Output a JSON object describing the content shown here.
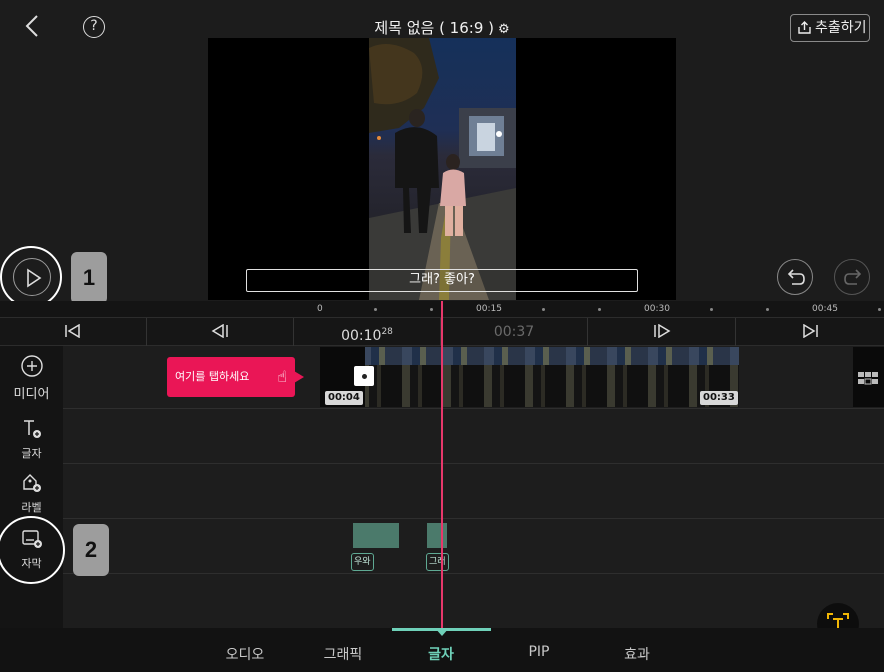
{
  "header": {
    "title": "제목 없음 ( 16:9 )",
    "export_label": "추출하기",
    "help_glyph": "?"
  },
  "preview": {
    "subtitle_text": "그래? 좋아?"
  },
  "annotations": {
    "badge_1": "1",
    "badge_2": "2"
  },
  "ruler": {
    "ticks": [
      "0",
      "00:15",
      "00:30",
      "00:45"
    ]
  },
  "navigation": {
    "current_time": "00:10",
    "current_frame": "28",
    "total_time": "00:37"
  },
  "sidebar": {
    "items": [
      {
        "label": "미디어",
        "icon": "add-circle-icon"
      },
      {
        "label": "글자",
        "icon": "text-add-icon"
      },
      {
        "label": "라벨",
        "icon": "label-add-icon"
      },
      {
        "label": "자막",
        "icon": "caption-add-icon"
      }
    ]
  },
  "timeline": {
    "tooltip": "여기를 탭하세요",
    "clip_start": "00:04",
    "clip_end": "00:33",
    "caption_clips": [
      "우와",
      "그래"
    ]
  },
  "tabs": [
    {
      "label": "오디오",
      "active": false
    },
    {
      "label": "그래픽",
      "active": false
    },
    {
      "label": "글자",
      "active": true
    },
    {
      "label": "PIP",
      "active": false
    },
    {
      "label": "효과",
      "active": false
    }
  ],
  "colors": {
    "accent": "#6fd1b9",
    "playhead": "#e7386b",
    "tooltip": "#ea1656",
    "ocr_icon": "#f2b705"
  }
}
